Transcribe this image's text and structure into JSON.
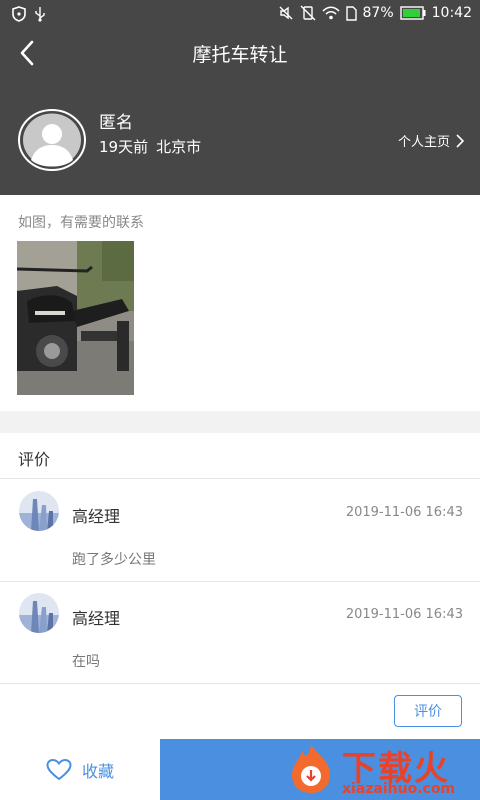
{
  "status_bar": {
    "battery_percent": "87%",
    "time": "10:42",
    "icons": [
      "shield-icon",
      "usb-icon",
      "mute-icon",
      "vibrate-off-icon",
      "wifi-icon",
      "sim-icon",
      "battery-icon"
    ]
  },
  "header": {
    "title": "摩托车转让",
    "back_icon": "chevron-left-icon"
  },
  "profile": {
    "name": "匿名",
    "time_ago": "19天前",
    "city": "北京市",
    "homepage_label": "个人主页"
  },
  "post": {
    "text": "如图，有需要的联系"
  },
  "comments": {
    "heading": "评价",
    "items": [
      {
        "author": "高经理",
        "time": "2019-11-06 16:43",
        "text": "跑了多少公里"
      },
      {
        "author": "高经理",
        "time": "2019-11-06 16:43",
        "text": "在吗"
      }
    ],
    "review_button": "评价"
  },
  "bottom_bar": {
    "favorite_label": "收藏"
  },
  "watermark": {
    "brand": "下载火",
    "domain": "xiazaihuo.com"
  },
  "colors": {
    "header_bg": "#474747",
    "accent": "#4a90e2",
    "watermark": "#e8432a"
  }
}
